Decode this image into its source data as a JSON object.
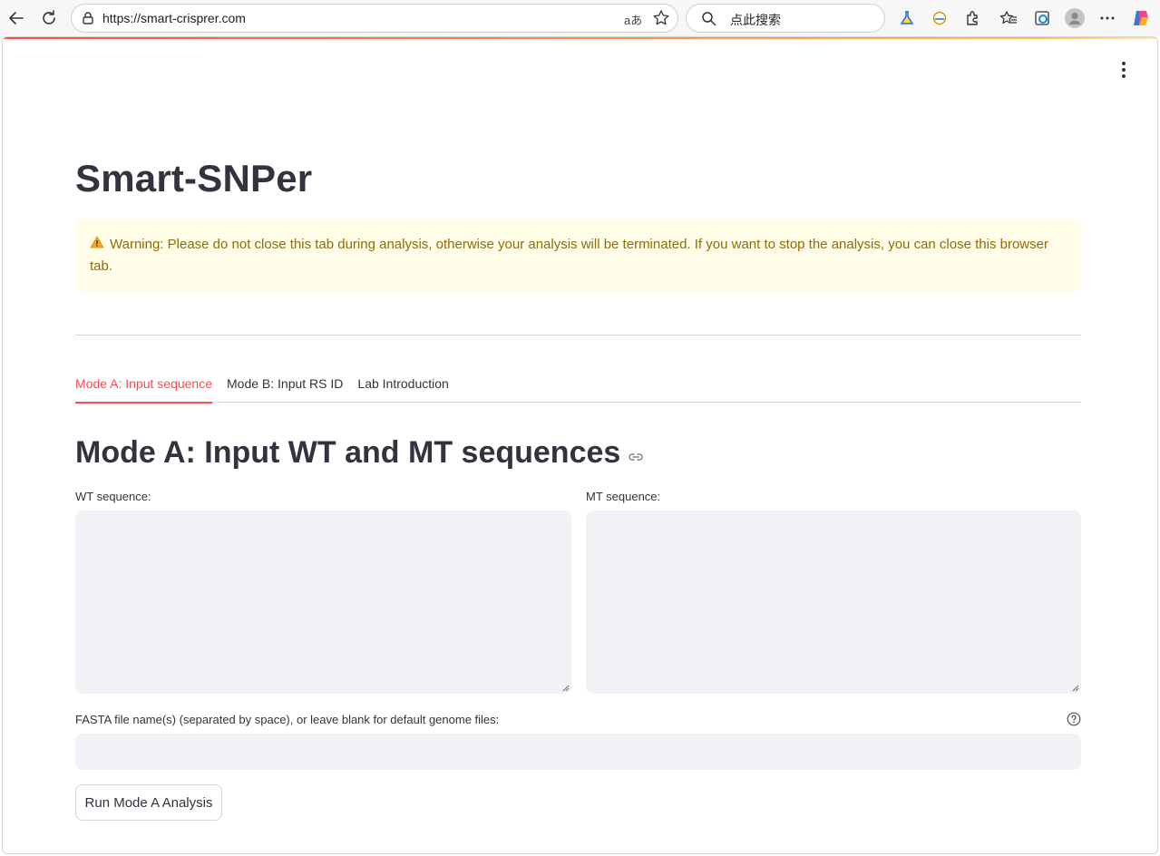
{
  "browser": {
    "url": "https://smart-crisprer.com",
    "translate_label": "aあ",
    "search_placeholder": "点此搜索"
  },
  "app": {
    "title": "Smart-SNPer",
    "warning_text": "Warning: Please do not close this tab during analysis, otherwise your analysis will be terminated. If you want to stop the analysis, you can close this browser tab."
  },
  "tabs": [
    {
      "label": "Mode A: Input sequence",
      "active": true
    },
    {
      "label": "Mode B: Input RS ID",
      "active": false
    },
    {
      "label": "Lab Introduction",
      "active": false
    }
  ],
  "mode_a": {
    "heading": "Mode A: Input WT and MT sequences",
    "wt_label": "WT sequence:",
    "wt_value": "",
    "mt_label": "MT sequence:",
    "mt_value": "",
    "fasta_label": "FASTA file name(s) (separated by space), or leave blank for default genome files:",
    "fasta_value": "",
    "run_button": "Run Mode A Analysis"
  },
  "colors": {
    "accent": "#ff4b4b",
    "warning_bg": "#fffce7",
    "warning_text": "#926c05",
    "input_bg": "#f0f2f6"
  }
}
